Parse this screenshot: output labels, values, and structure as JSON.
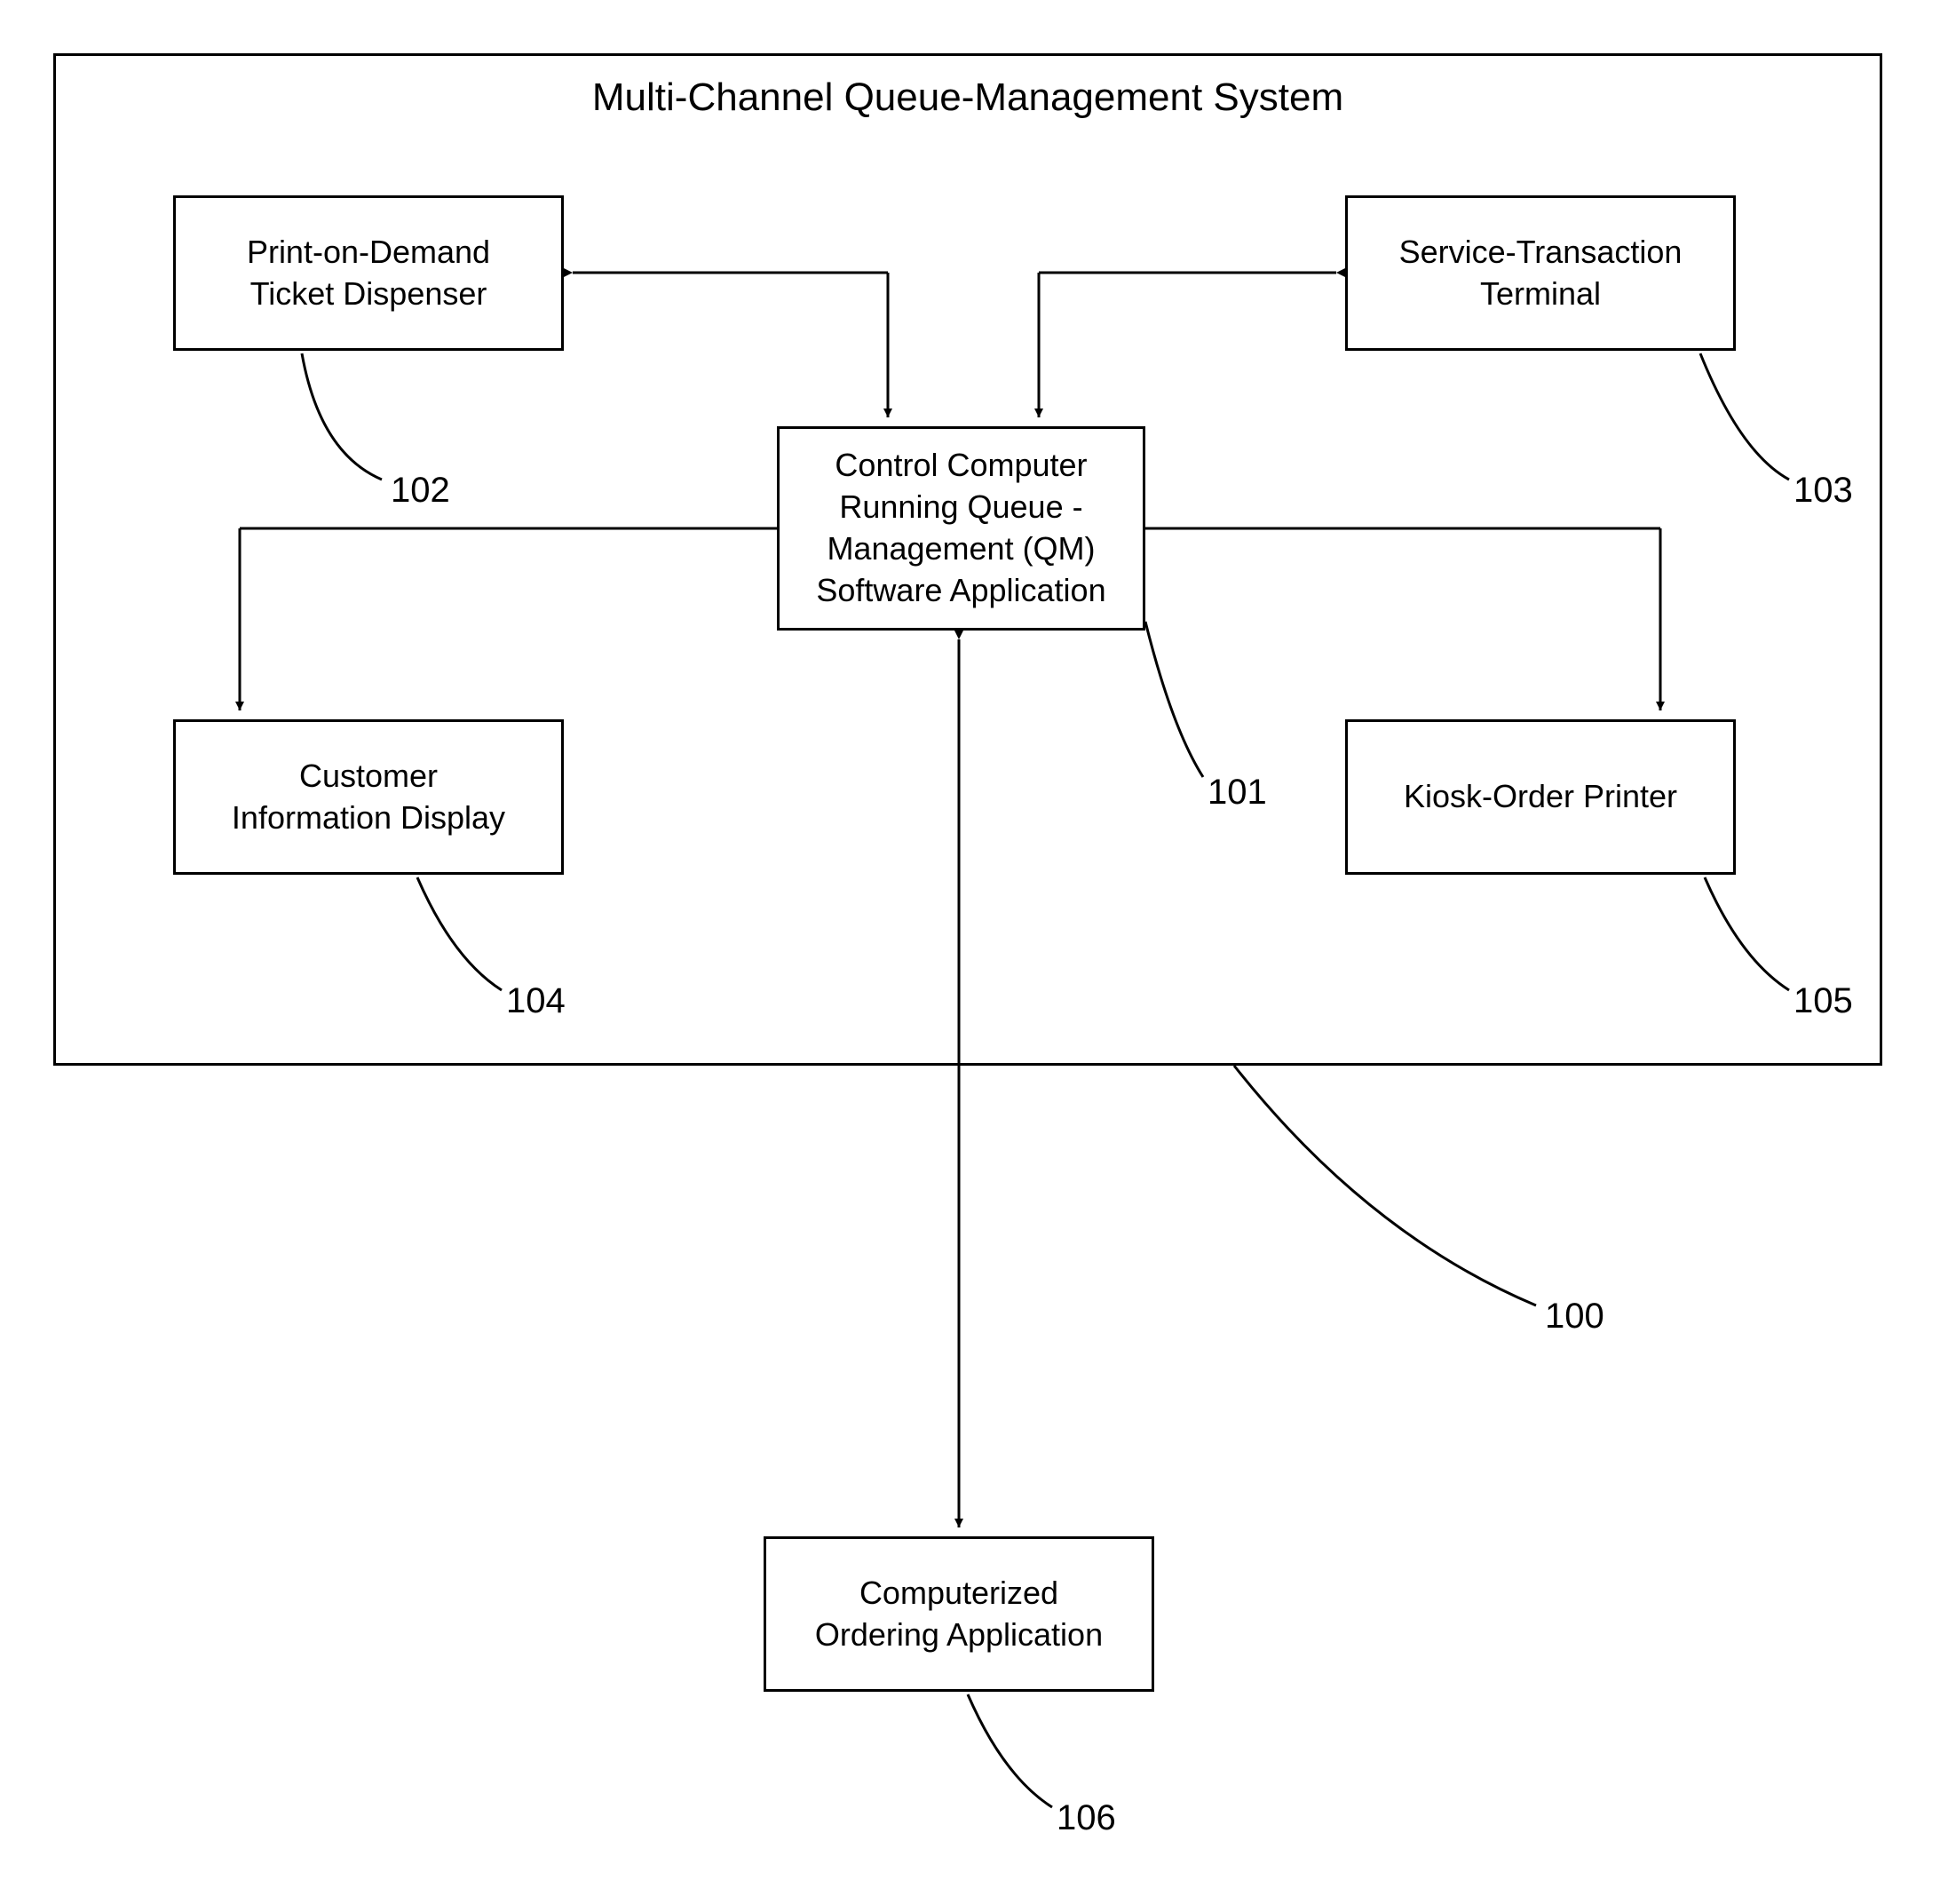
{
  "diagram": {
    "title": "Multi-Channel Queue-Management System",
    "boxes": {
      "ticket_dispenser": "Print-on-Demand\nTicket Dispenser",
      "service_terminal": "Service-Transaction\nTerminal",
      "control_computer": "Control Computer\nRunning Queue -\nManagement (QM)\nSoftware Application",
      "customer_display": "Customer\nInformation Display",
      "kiosk_printer": "Kiosk-Order Printer",
      "ordering_app": "Computerized\nOrdering Application"
    },
    "refs": {
      "r100": "100",
      "r101": "101",
      "r102": "102",
      "r103": "103",
      "r104": "104",
      "r105": "105",
      "r106": "106"
    }
  }
}
